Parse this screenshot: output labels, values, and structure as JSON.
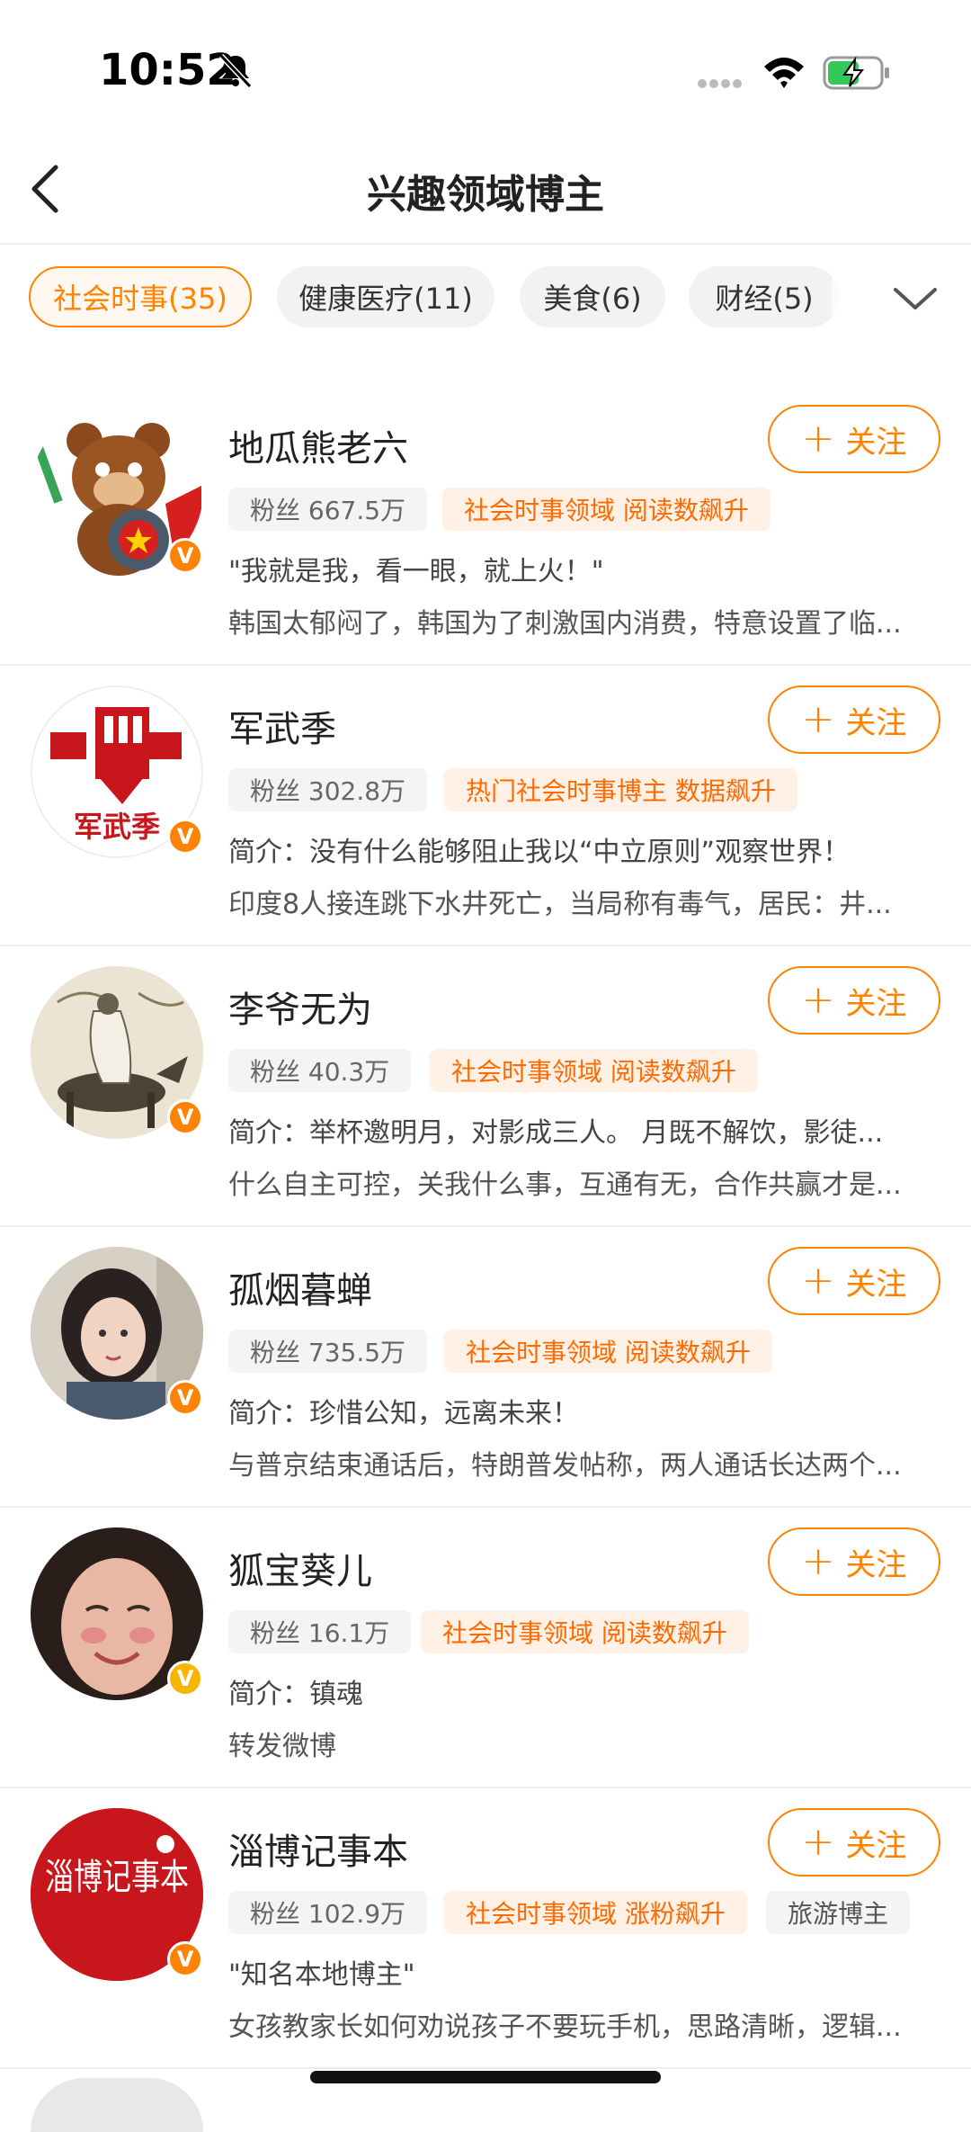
{
  "status_bar": {
    "time": "10:52"
  },
  "nav": {
    "title": "兴趣领域博主"
  },
  "tabs": [
    {
      "label": "社会时事(35)",
      "active": true
    },
    {
      "label": "健康医疗(11)",
      "active": false
    },
    {
      "label": "美食(6)",
      "active": false
    },
    {
      "label": "财经(5)",
      "active": false
    }
  ],
  "follow_label": "关注",
  "users": [
    {
      "name": "地瓜熊老六",
      "fans": "粉丝 667.5万",
      "tags": [
        "社会时事领域 阅读数飙升"
      ],
      "bio": "\"我就是我，看一眼，就上火！\"",
      "post": "韩国太郁闷了，韩国为了刺激国内消费，特意设置了临...",
      "badge": "V"
    },
    {
      "name": "军武季",
      "fans": "粉丝 302.8万",
      "tags": [
        "热门社会时事博主 数据飙升"
      ],
      "bio": "简介：没有什么能够阻止我以“中立原则”观察世界！",
      "post": "印度8人接连跳下水井死亡，当局称有毒气，居民：井...",
      "badge": "V",
      "avatar_text": "军武季"
    },
    {
      "name": "李爷无为",
      "fans": "粉丝 40.3万",
      "tags": [
        "社会时事领域 阅读数飙升"
      ],
      "bio": "简介：举杯邀明月，对影成三人。 月既不解饮，影徒...",
      "post": "什么自主可控，关我什么事，互通有无，合作共赢才是...",
      "badge": "V"
    },
    {
      "name": "孤烟暮蝉",
      "fans": "粉丝 735.5万",
      "tags": [
        "社会时事领域 阅读数飙升"
      ],
      "bio": "简介：珍惜公知，远离未来！",
      "post": "与普京结束通话后，特朗普发帖称，两人通话长达两个...",
      "badge": "V"
    },
    {
      "name": "狐宝葵儿",
      "fans": "粉丝 16.1万",
      "tags": [
        "社会时事领域 阅读数飙升"
      ],
      "bio": "简介：镇魂",
      "post": "转发微博",
      "badge": "V"
    },
    {
      "name": "淄博记事本",
      "fans": "粉丝 102.9万",
      "tags": [
        "社会时事领域 涨粉飙升",
        "旅游博主"
      ],
      "bio": "\"知名本地博主\"",
      "post": "女孩教家长如何劝说孩子不要玩手机，思路清晰，逻辑...",
      "badge": "V",
      "avatar_text": "淄博记事本"
    }
  ],
  "colors": {
    "accent": "#ff8200",
    "tag_bg": "#fff1e6",
    "badge_gold": "#f7b500"
  }
}
